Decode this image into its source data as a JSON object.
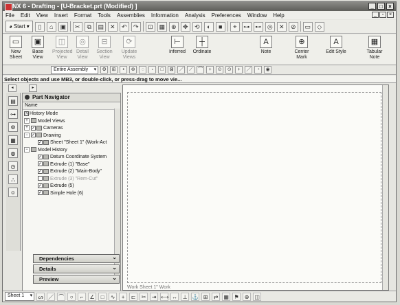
{
  "window": {
    "title": "NX 6 - Drafting - [U-Bracket.prt (Modified) ]",
    "controls": [
      "_",
      "□",
      "×"
    ]
  },
  "menu": [
    "File",
    "Edit",
    "View",
    "Insert",
    "Format",
    "Tools",
    "Assemblies",
    "Information",
    "Analysis",
    "Preferences",
    "Window",
    "Help"
  ],
  "start_label": "Start",
  "ribbon": [
    {
      "label": "New Sheet",
      "enabled": true
    },
    {
      "label": "Base View",
      "enabled": true
    },
    {
      "label": "Projected View",
      "enabled": false
    },
    {
      "label": "Detail View",
      "enabled": false
    },
    {
      "label": "Section View",
      "enabled": false
    },
    {
      "label": "Update Views",
      "enabled": false
    },
    {
      "label": "Inferred",
      "enabled": true
    },
    {
      "label": "Ordinate",
      "enabled": true
    },
    {
      "label": "Note",
      "enabled": true
    },
    {
      "label": "Center Mark",
      "enabled": true
    },
    {
      "label": "Edit Style",
      "enabled": true
    },
    {
      "label": "Tabular Note",
      "enabled": true
    }
  ],
  "selection_filter": "Entire Assembly",
  "cue_line": "Select objects and use MB3, or double-click, or press-drag to move vie...",
  "navigator": {
    "title": "Part Navigator",
    "column": "Name",
    "nodes": [
      {
        "label": "History Mode",
        "indent": 0,
        "dim": false
      },
      {
        "label": "Model Views",
        "indent": 0,
        "dim": false
      },
      {
        "label": "Cameras",
        "indent": 0,
        "dim": false
      },
      {
        "label": "Drawing",
        "indent": 0,
        "dim": false
      },
      {
        "label": "Sheet \"Sheet 1\" (Work-Act",
        "indent": 1,
        "dim": false
      },
      {
        "label": "Model History",
        "indent": 0,
        "dim": false
      },
      {
        "label": "Datum Coordinate System",
        "indent": 1,
        "dim": false
      },
      {
        "label": "Extrude (1) \"Base\"",
        "indent": 1,
        "dim": false
      },
      {
        "label": "Extrude (2) \"Main-Body\"",
        "indent": 1,
        "dim": false
      },
      {
        "label": "Extrude (3) \"Rem-Cut\"",
        "indent": 1,
        "dim": true
      },
      {
        "label": "Extrude (5)",
        "indent": 1,
        "dim": false
      },
      {
        "label": "Simple Hole (6)",
        "indent": 1,
        "dim": false
      }
    ]
  },
  "panels": [
    "Dependencies",
    "Details",
    "Preview"
  ],
  "sheet_label": "Work Sheet 1\" Work",
  "bottom_sheet": "Sheet 1"
}
